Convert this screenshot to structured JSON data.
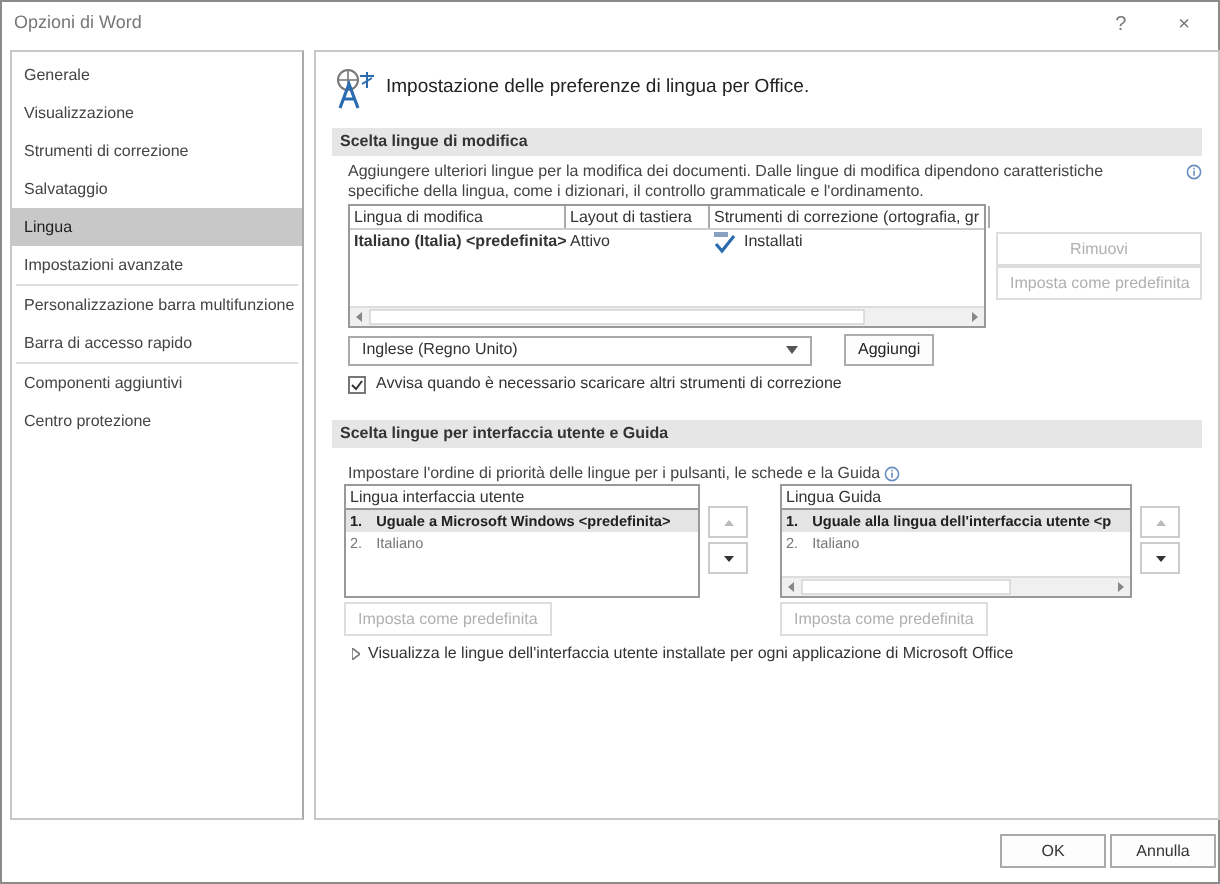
{
  "window": {
    "title": "Opzioni di Word",
    "controls": [
      "?",
      "×"
    ]
  },
  "sidebar": {
    "groups": [
      {
        "items": [
          {
            "label": "Generale",
            "selected": false
          },
          {
            "label": "Visualizzazione",
            "selected": false
          },
          {
            "label": "Strumenti di correzione",
            "selected": false
          },
          {
            "label": "Salvataggio",
            "selected": false
          },
          {
            "label": "Lingua",
            "selected": true
          },
          {
            "label": "Impostazioni avanzate",
            "selected": false
          }
        ]
      },
      {
        "items": [
          {
            "label": "Personalizzazione barra multifunzione",
            "selected": false
          },
          {
            "label": "Barra di accesso rapido",
            "selected": false
          }
        ]
      },
      {
        "items": [
          {
            "label": "Componenti aggiuntivi",
            "selected": false
          },
          {
            "label": "Centro protezione",
            "selected": false
          }
        ]
      }
    ]
  },
  "header": "Impostazione delle preferenze di lingua per Office.",
  "editing": {
    "title": "Scelta lingue di modifica",
    "description": "Aggiungere ulteriori lingue per la modifica dei documenti. Dalle lingue di modifica dipendono caratteristiche specifiche della lingua, come i dizionari, il controllo grammaticale e l'ordinamento.",
    "columns": [
      "Lingua di modifica",
      "Layout di tastiera",
      "Strumenti di correzione (ortografia, gr"
    ],
    "rows": [
      {
        "language": "Italiano (Italia) <predefinita>",
        "keyboard": "Attivo",
        "proofing": "Installati"
      }
    ],
    "side_buttons": [
      {
        "label": "Rimuovi",
        "disabled": true
      },
      {
        "label": "Imposta come predefinita",
        "disabled": true
      }
    ],
    "language_dropdown": "Inglese (Regno Unito)",
    "add_button": "Aggiungi",
    "notify": {
      "label": "Avvisa quando è necessario scaricare altri strumenti di correzione",
      "checked": true
    }
  },
  "interface": {
    "title": "Scelta lingue per interfaccia utente e Guida",
    "description": "Impostare l'ordine di priorità delle lingue per i pulsanti, le schede e la Guida",
    "lists": [
      {
        "header": "Lingua interfaccia utente",
        "scrollbar": false,
        "items": [
          {
            "number": "1.",
            "label": "Uguale a Microsoft Windows <predefinita>",
            "selected": true
          },
          {
            "number": "2.",
            "label": "Italiano",
            "selected": false
          }
        ],
        "default_button": {
          "label": "Imposta come predefinita",
          "disabled": true
        }
      },
      {
        "header": "Lingua Guida",
        "scrollbar": true,
        "items": [
          {
            "number": "1.",
            "label": "Uguale alla lingua dell'interfaccia utente <p",
            "selected": true
          },
          {
            "number": "2.",
            "label": "Italiano",
            "selected": false
          }
        ],
        "default_button": {
          "label": "Imposta come predefinita",
          "disabled": true
        }
      }
    ],
    "expander": {
      "label": "Visualizza le lingue dell'interfaccia utente installate per ogni applicazione di Microsoft Office",
      "expanded": false
    }
  },
  "footer_buttons": [
    "OK",
    "Annulla"
  ]
}
